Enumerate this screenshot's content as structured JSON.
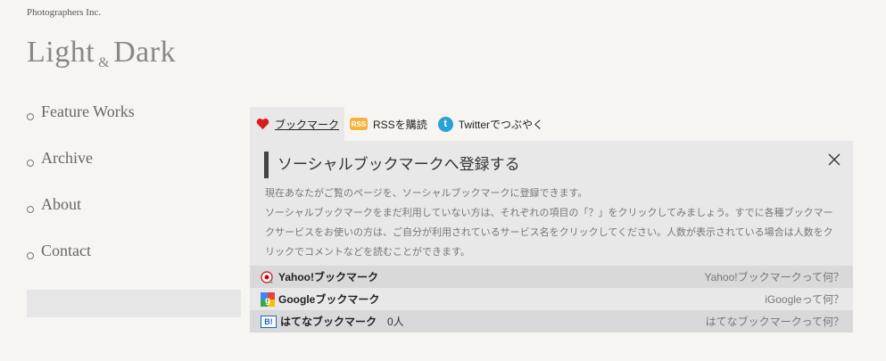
{
  "header": {
    "company": "Photographers Inc.",
    "logo_left": "Light",
    "logo_amp": "&",
    "logo_right": "Dark"
  },
  "nav": {
    "items": [
      {
        "label": "Feature Works"
      },
      {
        "label": "Archive"
      },
      {
        "label": "About"
      },
      {
        "label": "Contact"
      }
    ]
  },
  "tabs": [
    {
      "label": "ブックマーク",
      "icon": "heart-icon"
    },
    {
      "label": "RSSを購読",
      "icon": "rss-icon",
      "icon_text": "RSS"
    },
    {
      "label": "Twitterでつぶやく",
      "icon": "twitter-icon",
      "icon_text": "t"
    }
  ],
  "panel": {
    "title": "ソーシャルブックマークへ登録する",
    "desc1": "現在あなたがご覧のページを、ソーシャルブックマークに登録できます。",
    "desc2": "ソーシャルブックマークをまだ利用していない方は、それぞれの項目の「？」をクリックしてみましょう。すでに各種ブックマークサービスをお使いの方は、ご自分が利用されているサービス名をクリックしてください。人数が表示されている場合は人数をクリックでコメントなどを読むことができます。",
    "services": [
      {
        "name": "Yahoo!ブックマーク",
        "count": "",
        "help": "Yahoo!ブックマークって何？",
        "icon": "yahoo-icon"
      },
      {
        "name": "Googleブックマーク",
        "count": "",
        "help": "iGoogleって何？",
        "icon": "google-icon"
      },
      {
        "name": "はてなブックマーク",
        "count": "0人",
        "help": "はてなブックマークって何？",
        "icon": "hatena-icon",
        "icon_text": "B!"
      }
    ]
  },
  "colors": {
    "background": "#f7f5f2",
    "panel": "#e8e8e8",
    "heart": "#d81b1b",
    "rss": "#f4b23f",
    "twitter": "#2aa2d8"
  }
}
